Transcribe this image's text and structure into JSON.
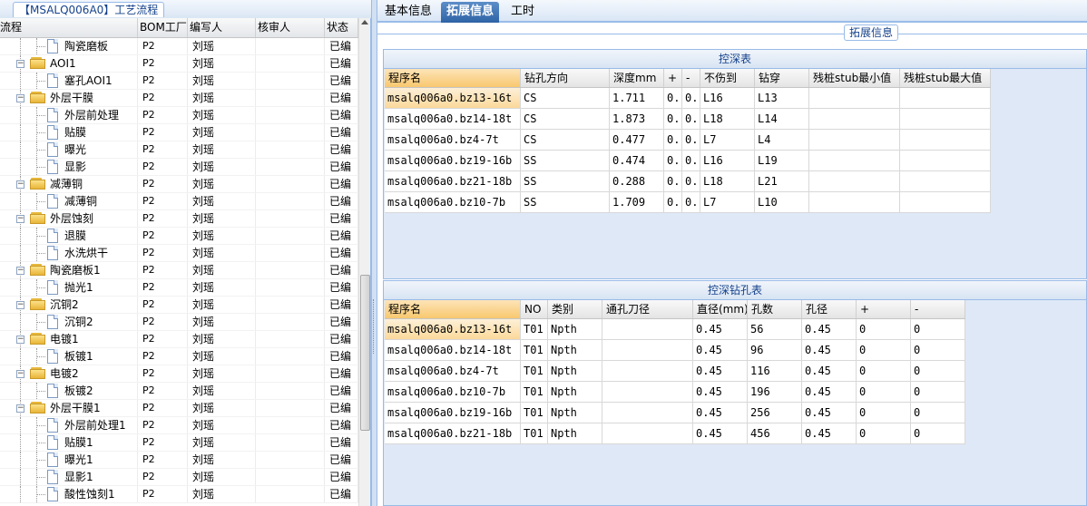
{
  "left_panel": {
    "title": "【MSALQ006A0】工艺流程",
    "columns": [
      "流程",
      "BOM工厂",
      "编写人",
      "核审人",
      "状态"
    ],
    "rows": [
      {
        "label": "陶瓷磨板",
        "kind": "doc",
        "depth": 2,
        "bom": "P2",
        "writer": "刘瑶",
        "reviewer": "",
        "status": "已编"
      },
      {
        "label": "AOI1",
        "kind": "folder",
        "depth": 1,
        "bom": "P2",
        "writer": "刘瑶",
        "reviewer": "",
        "status": "已编"
      },
      {
        "label": "塞孔AOI1",
        "kind": "doc",
        "depth": 2,
        "bom": "P2",
        "writer": "刘瑶",
        "reviewer": "",
        "status": "已编"
      },
      {
        "label": "外层干膜",
        "kind": "folder",
        "depth": 1,
        "bom": "P2",
        "writer": "刘瑶",
        "reviewer": "",
        "status": "已编"
      },
      {
        "label": "外层前处理",
        "kind": "doc",
        "depth": 2,
        "bom": "P2",
        "writer": "刘瑶",
        "reviewer": "",
        "status": "已编"
      },
      {
        "label": "贴膜",
        "kind": "doc",
        "depth": 2,
        "bom": "P2",
        "writer": "刘瑶",
        "reviewer": "",
        "status": "已编"
      },
      {
        "label": "曝光",
        "kind": "doc",
        "depth": 2,
        "bom": "P2",
        "writer": "刘瑶",
        "reviewer": "",
        "status": "已编"
      },
      {
        "label": "显影",
        "kind": "doc",
        "depth": 2,
        "bom": "P2",
        "writer": "刘瑶",
        "reviewer": "",
        "status": "已编"
      },
      {
        "label": "减薄铜",
        "kind": "folder",
        "depth": 1,
        "bom": "P2",
        "writer": "刘瑶",
        "reviewer": "",
        "status": "已编"
      },
      {
        "label": "减薄铜",
        "kind": "doc",
        "depth": 2,
        "bom": "P2",
        "writer": "刘瑶",
        "reviewer": "",
        "status": "已编"
      },
      {
        "label": "外层蚀刻",
        "kind": "folder",
        "depth": 1,
        "bom": "P2",
        "writer": "刘瑶",
        "reviewer": "",
        "status": "已编"
      },
      {
        "label": "退膜",
        "kind": "doc",
        "depth": 2,
        "bom": "P2",
        "writer": "刘瑶",
        "reviewer": "",
        "status": "已编"
      },
      {
        "label": "水洗烘干",
        "kind": "doc",
        "depth": 2,
        "bom": "P2",
        "writer": "刘瑶",
        "reviewer": "",
        "status": "已编"
      },
      {
        "label": "陶瓷磨板1",
        "kind": "folder",
        "depth": 1,
        "bom": "P2",
        "writer": "刘瑶",
        "reviewer": "",
        "status": "已编"
      },
      {
        "label": "抛光1",
        "kind": "doc",
        "depth": 2,
        "bom": "P2",
        "writer": "刘瑶",
        "reviewer": "",
        "status": "已编"
      },
      {
        "label": "沉铜2",
        "kind": "folder",
        "depth": 1,
        "bom": "P2",
        "writer": "刘瑶",
        "reviewer": "",
        "status": "已编"
      },
      {
        "label": "沉铜2",
        "kind": "doc",
        "depth": 2,
        "bom": "P2",
        "writer": "刘瑶",
        "reviewer": "",
        "status": "已编"
      },
      {
        "label": "电镀1",
        "kind": "folder",
        "depth": 1,
        "bom": "P2",
        "writer": "刘瑶",
        "reviewer": "",
        "status": "已编"
      },
      {
        "label": "板镀1",
        "kind": "doc",
        "depth": 2,
        "bom": "P2",
        "writer": "刘瑶",
        "reviewer": "",
        "status": "已编"
      },
      {
        "label": "电镀2",
        "kind": "folder",
        "depth": 1,
        "bom": "P2",
        "writer": "刘瑶",
        "reviewer": "",
        "status": "已编"
      },
      {
        "label": "板镀2",
        "kind": "doc",
        "depth": 2,
        "bom": "P2",
        "writer": "刘瑶",
        "reviewer": "",
        "status": "已编"
      },
      {
        "label": "外层干膜1",
        "kind": "folder",
        "depth": 1,
        "bom": "P2",
        "writer": "刘瑶",
        "reviewer": "",
        "status": "已编"
      },
      {
        "label": "外层前处理1",
        "kind": "doc",
        "depth": 2,
        "bom": "P2",
        "writer": "刘瑶",
        "reviewer": "",
        "status": "已编"
      },
      {
        "label": "贴膜1",
        "kind": "doc",
        "depth": 2,
        "bom": "P2",
        "writer": "刘瑶",
        "reviewer": "",
        "status": "已编"
      },
      {
        "label": "曝光1",
        "kind": "doc",
        "depth": 2,
        "bom": "P2",
        "writer": "刘瑶",
        "reviewer": "",
        "status": "已编"
      },
      {
        "label": "显影1",
        "kind": "doc",
        "depth": 2,
        "bom": "P2",
        "writer": "刘瑶",
        "reviewer": "",
        "status": "已编"
      },
      {
        "label": "酸性蚀刻1",
        "kind": "doc",
        "depth": 2,
        "bom": "P2",
        "writer": "刘瑶",
        "reviewer": "",
        "status": "已编"
      }
    ]
  },
  "tabs": [
    {
      "label": "基本信息",
      "active": false
    },
    {
      "label": "拓展信息",
      "active": true
    },
    {
      "label": "工时",
      "active": false
    }
  ],
  "extension_title": "拓展信息",
  "depth_table": {
    "title": "控深表",
    "columns": [
      "程序名",
      "钻孔方向",
      "深度mm",
      "+",
      "-",
      "不伤到",
      "钻穿",
      "残桩stub最小值",
      "残桩stub最大值"
    ],
    "rows": [
      [
        "msalq006a0.bz13-16t",
        "CS",
        "1.711",
        "0..",
        "0..",
        "L16",
        "L13",
        "",
        ""
      ],
      [
        "msalq006a0.bz14-18t",
        "CS",
        "1.873",
        "0..",
        "0..",
        "L18",
        "L14",
        "",
        ""
      ],
      [
        "msalq006a0.bz4-7t",
        "CS",
        "0.477",
        "0..",
        "0..",
        "L7",
        "L4",
        "",
        ""
      ],
      [
        "msalq006a0.bz19-16b",
        "SS",
        "0.474",
        "0..",
        "0..",
        "L16",
        "L19",
        "",
        ""
      ],
      [
        "msalq006a0.bz21-18b",
        "SS",
        "0.288",
        "0..",
        "0..",
        "L18",
        "L21",
        "",
        ""
      ],
      [
        "msalq006a0.bz10-7b",
        "SS",
        "1.709",
        "0..",
        "0..",
        "L7",
        "L10",
        "",
        ""
      ]
    ]
  },
  "hole_table": {
    "title": "控深钻孔表",
    "columns": [
      "程序名",
      "NO",
      "类别",
      "通孔刀径",
      "直径(mm)",
      "孔数",
      "孔径",
      "+",
      "-"
    ],
    "rows": [
      [
        "msalq006a0.bz13-16t",
        "T01",
        "Npth",
        "",
        "0.45",
        "56",
        "0.45",
        "0",
        "0"
      ],
      [
        "msalq006a0.bz14-18t",
        "T01",
        "Npth",
        "",
        "0.45",
        "96",
        "0.45",
        "0",
        "0"
      ],
      [
        "msalq006a0.bz4-7t",
        "T01",
        "Npth",
        "",
        "0.45",
        "116",
        "0.45",
        "0",
        "0"
      ],
      [
        "msalq006a0.bz10-7b",
        "T01",
        "Npth",
        "",
        "0.45",
        "196",
        "0.45",
        "0",
        "0"
      ],
      [
        "msalq006a0.bz19-16b",
        "T01",
        "Npth",
        "",
        "0.45",
        "256",
        "0.45",
        "0",
        "0"
      ],
      [
        "msalq006a0.bz21-18b",
        "T01",
        "Npth",
        "",
        "0.45",
        "456",
        "0.45",
        "0",
        "0"
      ]
    ]
  },
  "colors": {
    "accent": "#2e63a6",
    "border": "#99bbe8",
    "selected_cell": "#fbd89a"
  }
}
